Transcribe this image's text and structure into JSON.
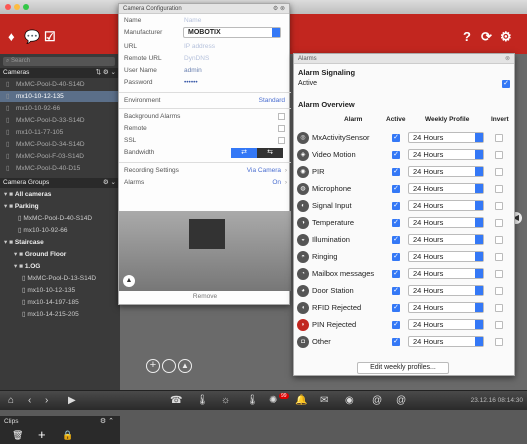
{
  "toolbar": {
    "help": "?",
    "refresh": "⟳",
    "settings": "⚙"
  },
  "sidebar": {
    "search_placeholder": "Search",
    "cameras_header": "Cameras",
    "cameras": [
      "MxMC-Pool-D-40-S14D",
      "mx10-10-12-135",
      "mx10-10-92-66",
      "MxMC-Pool-D-33-S14D",
      "mx10-11-77-105",
      "MxMC-Pool-D-34-S14D",
      "MxMC-Pool-F-03-S14D",
      "MxMC-Pool-D-40-D15"
    ],
    "camera_groups_header": "Camera Groups",
    "groups": [
      {
        "label": "All cameras",
        "bold": true,
        "indent": 4
      },
      {
        "label": "Parking",
        "bold": true,
        "indent": 4
      },
      {
        "label": "MxMC-Pool-D-40-S14D",
        "bold": false,
        "indent": 18
      },
      {
        "label": "mx10-10-92-66",
        "bold": false,
        "indent": 18
      },
      {
        "label": "Staircase",
        "bold": true,
        "indent": 4
      },
      {
        "label": "Ground Floor",
        "bold": true,
        "indent": 14
      },
      {
        "label": "1.OG",
        "bold": true,
        "indent": 14
      },
      {
        "label": "MxMC-Pool-D-13-S14D",
        "bold": false,
        "indent": 22
      },
      {
        "label": "mx10-10-12-135",
        "bold": false,
        "indent": 22
      },
      {
        "label": "mx10-14-197-185",
        "bold": false,
        "indent": 22
      },
      {
        "label": "mx10-14-215-205",
        "bold": false,
        "indent": 22
      }
    ],
    "clips_header": "Clips"
  },
  "camera_config": {
    "title": "Camera Configuration",
    "name_label": "Name",
    "name_value": "Name",
    "manufacturer_label": "Manufacturer",
    "manufacturer_value": "MOBOTIX",
    "url_label": "URL",
    "url_value": "IP address",
    "remote_url_label": "Remote URL",
    "remote_url_value": "DynDNS",
    "username_label": "User Name",
    "username_value": "admin",
    "password_label": "Password",
    "password_value": "••••••",
    "environment_label": "Environment",
    "environment_value": "Standard",
    "background_alarms_label": "Background Alarms",
    "remote_label": "Remote",
    "ssl_label": "SSL",
    "bandwidth_label": "Bandwidth",
    "recording_label": "Recording Settings",
    "recording_value": "Via Camera",
    "alarms_label": "Alarms",
    "alarms_value": "On",
    "remove_label": "Remove"
  },
  "alarms_panel": {
    "title": "Alarms",
    "signaling_header": "Alarm Signaling",
    "active_label": "Active",
    "overview_header": "Alarm Overview",
    "col_alarm": "Alarm",
    "col_active": "Active",
    "col_profile": "Weekly Profile",
    "col_invert": "Invert",
    "rows": [
      {
        "name": "MxActivitySensor",
        "profile": "24 Hours"
      },
      {
        "name": "Video Motion",
        "profile": "24 Hours"
      },
      {
        "name": "PIR",
        "profile": "24 Hours"
      },
      {
        "name": "Microphone",
        "profile": "24 Hours"
      },
      {
        "name": "Signal Input",
        "profile": "24 Hours"
      },
      {
        "name": "Temperature",
        "profile": "24 Hours"
      },
      {
        "name": "Illumination",
        "profile": "24 Hours"
      },
      {
        "name": "Ringing",
        "profile": "24 Hours"
      },
      {
        "name": "Mailbox messages",
        "profile": "24 Hours"
      },
      {
        "name": "Door Station",
        "profile": "24 Hours"
      },
      {
        "name": "RFID Rejected",
        "profile": "24 Hours"
      },
      {
        "name": "PIN Rejected",
        "profile": "24 Hours"
      },
      {
        "name": "Other",
        "profile": "24 Hours"
      }
    ],
    "edit_button": "Edit weekly profiles..."
  },
  "statusbar": {
    "datetime": "23.12.16 08:14:30",
    "badge": "99"
  },
  "colors": {
    "accent_red": "#c2261f",
    "accent_blue": "#3478f6",
    "selected": "#5b6f89"
  }
}
